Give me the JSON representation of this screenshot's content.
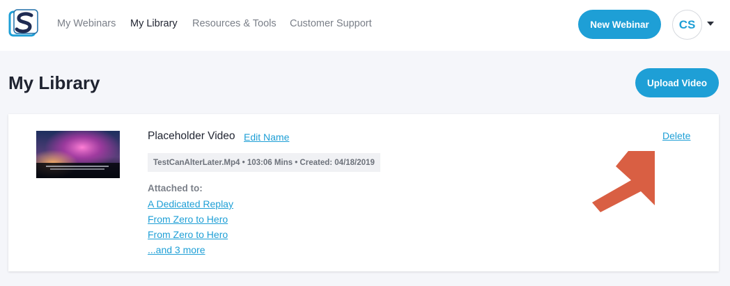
{
  "nav": {
    "items": [
      {
        "label": "My Webinars",
        "active": false
      },
      {
        "label": "My Library",
        "active": true
      },
      {
        "label": "Resources & Tools",
        "active": false
      },
      {
        "label": "Customer Support",
        "active": false
      }
    ],
    "new_webinar_label": "New Webinar",
    "avatar_initials": "CS"
  },
  "page": {
    "title": "My Library",
    "upload_label": "Upload Video"
  },
  "video": {
    "title": "Placeholder Video",
    "edit_label": "Edit Name",
    "delete_label": "Delete",
    "meta": "TestCanAlterLater.Mp4 • 103:06 Mins • Created: 04/18/2019",
    "attached_label": "Attached to:",
    "attached_items": [
      "A Dedicated Replay",
      "From Zero to Hero",
      "From Zero to Hero"
    ],
    "more_label": "...and 3 more"
  },
  "colors": {
    "accent": "#1e9fd6",
    "annotation_arrow": "#d95f43",
    "page_bg": "#f5f6fa"
  },
  "icons": {
    "logo": "s-logo-icon",
    "caret": "caret-down-icon",
    "annotation": "arrow-up-right-icon"
  }
}
